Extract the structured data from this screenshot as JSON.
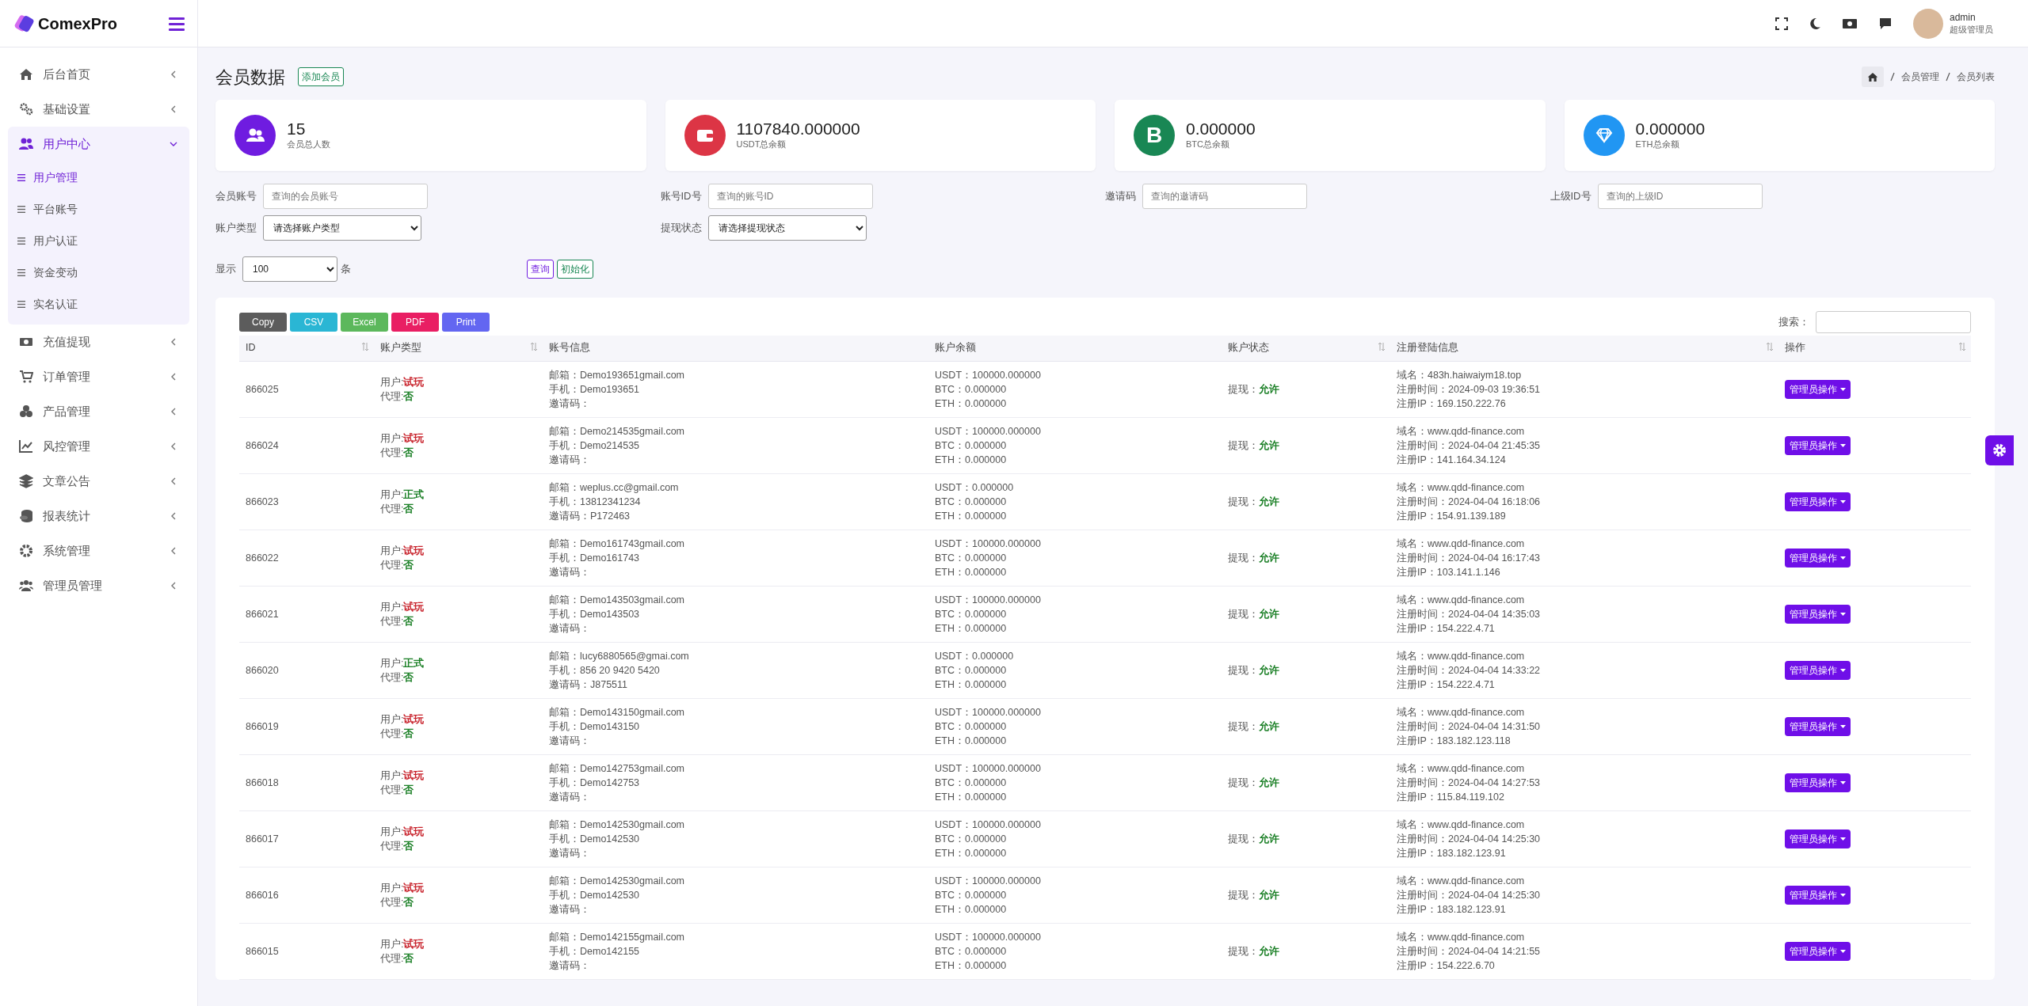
{
  "brand": {
    "name": "ComexPro"
  },
  "sidebar": {
    "items": [
      {
        "label": "后台首页",
        "expanded": false
      },
      {
        "label": "基础设置",
        "expanded": false
      },
      {
        "label": "用户中心",
        "expanded": true,
        "children": [
          {
            "label": "用户管理",
            "selected": true
          },
          {
            "label": "平台账号",
            "selected": false
          },
          {
            "label": "用户认证",
            "selected": false
          },
          {
            "label": "资金变动",
            "selected": false
          },
          {
            "label": "实名认证",
            "selected": false
          }
        ]
      },
      {
        "label": "充值提现",
        "expanded": false
      },
      {
        "label": "订单管理",
        "expanded": false
      },
      {
        "label": "产品管理",
        "expanded": false
      },
      {
        "label": "风控管理",
        "expanded": false
      },
      {
        "label": "文章公告",
        "expanded": false
      },
      {
        "label": "报表统计",
        "expanded": false
      },
      {
        "label": "系统管理",
        "expanded": false
      },
      {
        "label": "管理员管理",
        "expanded": false
      }
    ]
  },
  "header": {
    "user": {
      "name": "admin",
      "role": "超级管理员"
    }
  },
  "page": {
    "title": "会员数据",
    "add_button": "添加会员",
    "breadcrumb": [
      "会员管理",
      "会员列表"
    ]
  },
  "stats": [
    {
      "value": "15",
      "label": "会员总人数",
      "color": "#6f1ce0"
    },
    {
      "value": "1107840.000000",
      "label": "USDT总余额",
      "color": "#dc3545"
    },
    {
      "value": "0.000000",
      "label": "BTC总余额",
      "color": "#198754",
      "glyph": "B"
    },
    {
      "value": "0.000000",
      "label": "ETH总余额",
      "color": "#2196f3"
    }
  ],
  "filters": [
    {
      "label": "会员账号",
      "kind": "input",
      "placeholder": "查询的会员账号"
    },
    {
      "label": "账号ID号",
      "kind": "input",
      "placeholder": "查询的账号ID"
    },
    {
      "label": "邀请码",
      "kind": "input",
      "placeholder": "查询的邀请码"
    },
    {
      "label": "上级ID号",
      "kind": "input",
      "placeholder": "查询的上级ID"
    },
    {
      "label": "账户类型",
      "kind": "select",
      "value": "请选择账户类型"
    },
    {
      "label": "提现状态",
      "kind": "select",
      "value": "请选择提现状态"
    }
  ],
  "length": {
    "label": "显示",
    "value": "100",
    "unit": "条"
  },
  "actions": [
    {
      "label": "查询",
      "color": "#6f1ce0"
    },
    {
      "label": "初始化",
      "color": "#198754"
    }
  ],
  "export_buttons": [
    {
      "label": "Copy",
      "color": "#5c5c5c"
    },
    {
      "label": "CSV",
      "color": "#2ab6d4"
    },
    {
      "label": "Excel",
      "color": "#5cb85c"
    },
    {
      "label": "PDF",
      "color": "#e91e63"
    },
    {
      "label": "Print",
      "color": "#6366f1"
    }
  ],
  "search": {
    "label": "搜索："
  },
  "table": {
    "columns": [
      {
        "label": "ID",
        "sortable": true
      },
      {
        "label": "账户类型",
        "sortable": true
      },
      {
        "label": "账号信息",
        "sortable": false
      },
      {
        "label": "账户余额",
        "sortable": false
      },
      {
        "label": "账户状态",
        "sortable": true
      },
      {
        "label": "注册登陆信息",
        "sortable": true
      },
      {
        "label": "操作",
        "sortable": true
      }
    ],
    "rows": [
      {
        "id": "866025",
        "user": {
          "label": "用户:",
          "value": "试玩",
          "kind": "trial"
        },
        "agent": {
          "label": "代理:",
          "value": "否"
        },
        "account": [
          "邮箱：Demo193651gmail.com",
          "手机：Demo193651",
          "邀请码："
        ],
        "balance": [
          "USDT：100000.000000",
          "BTC：0.000000",
          "ETH：0.000000"
        ],
        "status": {
          "label": "提现：",
          "value": "允许"
        },
        "register": [
          "域名：483h.haiwaiym18.top",
          "注册时间：2024-09-03 19:36:51",
          "注册IP：169.150.222.76"
        ],
        "action": "管理员操作"
      },
      {
        "id": "866024",
        "user": {
          "label": "用户:",
          "value": "试玩",
          "kind": "trial"
        },
        "agent": {
          "label": "代理:",
          "value": "否"
        },
        "account": [
          "邮箱：Demo214535gmail.com",
          "手机：Demo214535",
          "邀请码："
        ],
        "balance": [
          "USDT：100000.000000",
          "BTC：0.000000",
          "ETH：0.000000"
        ],
        "status": {
          "label": "提现：",
          "value": "允许"
        },
        "register": [
          "域名：www.qdd-finance.com",
          "注册时间：2024-04-04 21:45:35",
          "注册IP：141.164.34.124"
        ],
        "action": "管理员操作"
      },
      {
        "id": "866023",
        "user": {
          "label": "用户:",
          "value": "正式",
          "kind": "formal"
        },
        "agent": {
          "label": "代理:",
          "value": "否"
        },
        "account": [
          "邮箱：weplus.cc@gmail.com",
          "手机：13812341234",
          "邀请码：P172463"
        ],
        "balance": [
          "USDT：0.000000",
          "BTC：0.000000",
          "ETH：0.000000"
        ],
        "status": {
          "label": "提现：",
          "value": "允许"
        },
        "register": [
          "域名：www.qdd-finance.com",
          "注册时间：2024-04-04 16:18:06",
          "注册IP：154.91.139.189"
        ],
        "action": "管理员操作"
      },
      {
        "id": "866022",
        "user": {
          "label": "用户:",
          "value": "试玩",
          "kind": "trial"
        },
        "agent": {
          "label": "代理:",
          "value": "否"
        },
        "account": [
          "邮箱：Demo161743gmail.com",
          "手机：Demo161743",
          "邀请码："
        ],
        "balance": [
          "USDT：100000.000000",
          "BTC：0.000000",
          "ETH：0.000000"
        ],
        "status": {
          "label": "提现：",
          "value": "允许"
        },
        "register": [
          "域名：www.qdd-finance.com",
          "注册时间：2024-04-04 16:17:43",
          "注册IP：103.141.1.146"
        ],
        "action": "管理员操作"
      },
      {
        "id": "866021",
        "user": {
          "label": "用户:",
          "value": "试玩",
          "kind": "trial"
        },
        "agent": {
          "label": "代理:",
          "value": "否"
        },
        "account": [
          "邮箱：Demo143503gmail.com",
          "手机：Demo143503",
          "邀请码："
        ],
        "balance": [
          "USDT：100000.000000",
          "BTC：0.000000",
          "ETH：0.000000"
        ],
        "status": {
          "label": "提现：",
          "value": "允许"
        },
        "register": [
          "域名：www.qdd-finance.com",
          "注册时间：2024-04-04 14:35:03",
          "注册IP：154.222.4.71"
        ],
        "action": "管理员操作"
      },
      {
        "id": "866020",
        "user": {
          "label": "用户:",
          "value": "正式",
          "kind": "formal"
        },
        "agent": {
          "label": "代理:",
          "value": "否"
        },
        "account": [
          "邮箱：lucy6880565@gmai.com",
          "手机：856 20 9420 5420",
          "邀请码：J875511"
        ],
        "balance": [
          "USDT：0.000000",
          "BTC：0.000000",
          "ETH：0.000000"
        ],
        "status": {
          "label": "提现：",
          "value": "允许"
        },
        "register": [
          "域名：www.qdd-finance.com",
          "注册时间：2024-04-04 14:33:22",
          "注册IP：154.222.4.71"
        ],
        "action": "管理员操作"
      },
      {
        "id": "866019",
        "user": {
          "label": "用户:",
          "value": "试玩",
          "kind": "trial"
        },
        "agent": {
          "label": "代理:",
          "value": "否"
        },
        "account": [
          "邮箱：Demo143150gmail.com",
          "手机：Demo143150",
          "邀请码："
        ],
        "balance": [
          "USDT：100000.000000",
          "BTC：0.000000",
          "ETH：0.000000"
        ],
        "status": {
          "label": "提现：",
          "value": "允许"
        },
        "register": [
          "域名：www.qdd-finance.com",
          "注册时间：2024-04-04 14:31:50",
          "注册IP：183.182.123.118"
        ],
        "action": "管理员操作"
      },
      {
        "id": "866018",
        "user": {
          "label": "用户:",
          "value": "试玩",
          "kind": "trial"
        },
        "agent": {
          "label": "代理:",
          "value": "否"
        },
        "account": [
          "邮箱：Demo142753gmail.com",
          "手机：Demo142753",
          "邀请码："
        ],
        "balance": [
          "USDT：100000.000000",
          "BTC：0.000000",
          "ETH：0.000000"
        ],
        "status": {
          "label": "提现：",
          "value": "允许"
        },
        "register": [
          "域名：www.qdd-finance.com",
          "注册时间：2024-04-04 14:27:53",
          "注册IP：115.84.119.102"
        ],
        "action": "管理员操作"
      },
      {
        "id": "866017",
        "user": {
          "label": "用户:",
          "value": "试玩",
          "kind": "trial"
        },
        "agent": {
          "label": "代理:",
          "value": "否"
        },
        "account": [
          "邮箱：Demo142530gmail.com",
          "手机：Demo142530",
          "邀请码："
        ],
        "balance": [
          "USDT：100000.000000",
          "BTC：0.000000",
          "ETH：0.000000"
        ],
        "status": {
          "label": "提现：",
          "value": "允许"
        },
        "register": [
          "域名：www.qdd-finance.com",
          "注册时间：2024-04-04 14:25:30",
          "注册IP：183.182.123.91"
        ],
        "action": "管理员操作"
      },
      {
        "id": "866016",
        "user": {
          "label": "用户:",
          "value": "试玩",
          "kind": "trial"
        },
        "agent": {
          "label": "代理:",
          "value": "否"
        },
        "account": [
          "邮箱：Demo142530gmail.com",
          "手机：Demo142530",
          "邀请码："
        ],
        "balance": [
          "USDT：100000.000000",
          "BTC：0.000000",
          "ETH：0.000000"
        ],
        "status": {
          "label": "提现：",
          "value": "允许"
        },
        "register": [
          "域名：www.qdd-finance.com",
          "注册时间：2024-04-04 14:25:30",
          "注册IP：183.182.123.91"
        ],
        "action": "管理员操作"
      },
      {
        "id": "866015",
        "user": {
          "label": "用户:",
          "value": "试玩",
          "kind": "trial"
        },
        "agent": {
          "label": "代理:",
          "value": "否"
        },
        "account": [
          "邮箱：Demo142155gmail.com",
          "手机：Demo142155",
          "邀请码："
        ],
        "balance": [
          "USDT：100000.000000",
          "BTC：0.000000",
          "ETH：0.000000"
        ],
        "status": {
          "label": "提现：",
          "value": "允许"
        },
        "register": [
          "域名：www.qdd-finance.com",
          "注册时间：2024-04-04 14:21:55",
          "注册IP：154.222.6.70"
        ],
        "action": "管理员操作"
      }
    ]
  }
}
